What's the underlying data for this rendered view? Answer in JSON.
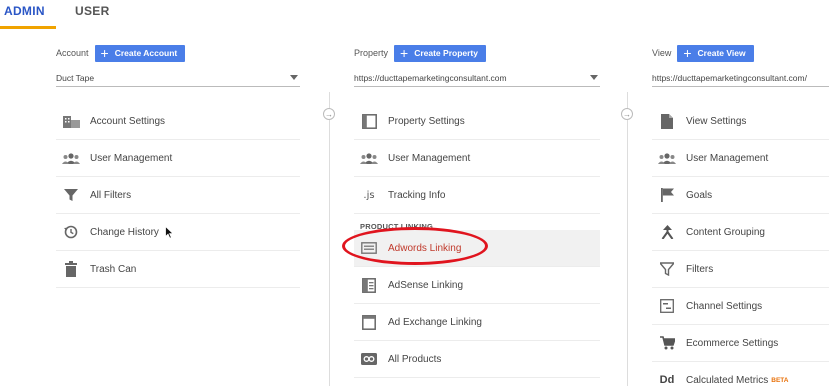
{
  "tabs": [
    {
      "label": "ADMIN",
      "active": true
    },
    {
      "label": "USER",
      "active": false
    }
  ],
  "account": {
    "label": "Account",
    "create_label": "Create Account",
    "selected": "Duct Tape",
    "items": [
      {
        "label": "Account Settings",
        "icon": "building-icon"
      },
      {
        "label": "User Management",
        "icon": "people-icon"
      },
      {
        "label": "All Filters",
        "icon": "filter-icon"
      },
      {
        "label": "Change History",
        "icon": "history-icon"
      },
      {
        "label": "Trash Can",
        "icon": "trash-icon"
      }
    ]
  },
  "property": {
    "label": "Property",
    "create_label": "Create Property",
    "selected": "https://ducttapemarketingconsultant.com",
    "items": [
      {
        "label": "Property Settings",
        "icon": "window-icon"
      },
      {
        "label": "User Management",
        "icon": "people-icon"
      },
      {
        "label": "Tracking Info",
        "icon": "js-icon",
        "glyph": ".js"
      }
    ],
    "section_heading": "PRODUCT LINKING",
    "linking_items": [
      {
        "label": "Adwords Linking",
        "icon": "adwords-icon",
        "highlighted": true
      },
      {
        "label": "AdSense Linking",
        "icon": "adsense-icon"
      },
      {
        "label": "Ad Exchange Linking",
        "icon": "ad-exchange-icon"
      },
      {
        "label": "All Products",
        "icon": "link-icon"
      }
    ]
  },
  "view": {
    "label": "View",
    "create_label": "Create View",
    "selected": "https://ducttapemarketingconsultant.com/",
    "items": [
      {
        "label": "View Settings",
        "icon": "document-icon"
      },
      {
        "label": "User Management",
        "icon": "people-icon"
      },
      {
        "label": "Goals",
        "icon": "flag-icon"
      },
      {
        "label": "Content Grouping",
        "icon": "grouping-icon"
      },
      {
        "label": "Filters",
        "icon": "filter-icon"
      },
      {
        "label": "Channel Settings",
        "icon": "channel-icon"
      },
      {
        "label": "Ecommerce Settings",
        "icon": "cart-icon"
      },
      {
        "label": "Calculated Metrics",
        "icon": "dd-icon",
        "glyph": "Dd",
        "badge": "BETA"
      }
    ]
  },
  "colors": {
    "accent": "#4a7ee8",
    "tab_active": "#2a56c6",
    "tab_underline": "#f0a300",
    "highlight_text": "#c0392b",
    "annotation": "#e0141e",
    "beta": "#e8710a"
  }
}
